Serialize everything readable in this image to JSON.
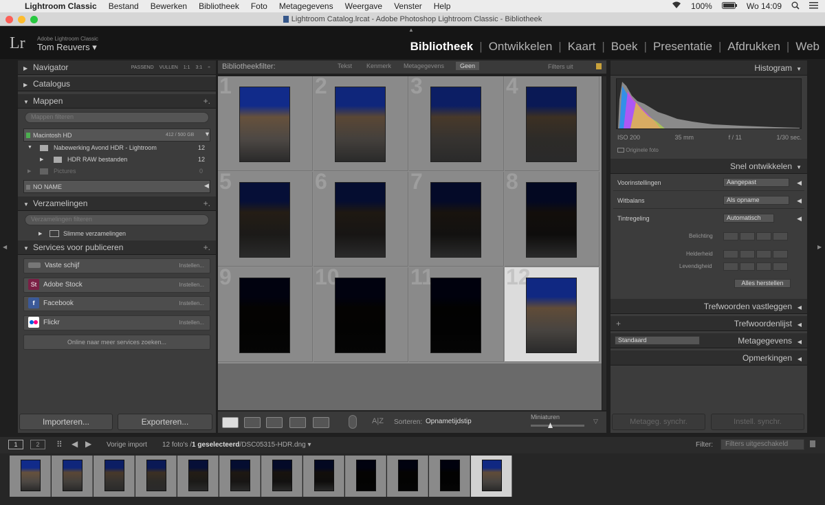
{
  "menubar": {
    "app": "Lightroom Classic",
    "items": [
      "Bestand",
      "Bewerken",
      "Bibliotheek",
      "Foto",
      "Metagegevens",
      "Weergave",
      "Venster",
      "Help"
    ],
    "battery": "100%",
    "clock": "Wo 14:09"
  },
  "window": {
    "title": "Lightroom Catalog.lrcat - Adobe Photoshop Lightroom Classic - Bibliotheek"
  },
  "identity": {
    "logo": "Lr",
    "product": "Adobe Lightroom Classic",
    "user": "Tom Reuvers ▾"
  },
  "modules": {
    "items": [
      "Bibliotheek",
      "Ontwikkelen",
      "Kaart",
      "Boek",
      "Presentatie",
      "Afdrukken",
      "Web"
    ],
    "active": "Bibliotheek"
  },
  "left": {
    "navigator": {
      "label": "Navigator",
      "zoom": [
        "PASSEND",
        "VULLEN",
        "1:1",
        "3:1"
      ]
    },
    "catalog": {
      "label": "Catalogus"
    },
    "folders": {
      "label": "Mappen",
      "search_placeholder": "Mappen filteren",
      "volume": {
        "name": "Macintosh HD",
        "size": "412 / 500 GB"
      },
      "items": [
        {
          "name": "Nabewerking Avond HDR - Lightroom",
          "count": "12"
        },
        {
          "name": "HDR RAW bestanden",
          "count": "12"
        },
        {
          "name": "Pictures",
          "count": "0"
        }
      ],
      "volume2": "NO NAME"
    },
    "collections": {
      "label": "Verzamelingen",
      "search_placeholder": "Verzamelingen filteren",
      "item": "Slimme verzamelingen"
    },
    "publish": {
      "label": "Services voor publiceren",
      "services": [
        {
          "name": "Vaste schijf",
          "action": "Instellen..."
        },
        {
          "name": "Adobe Stock",
          "action": "Instellen..."
        },
        {
          "name": "Facebook",
          "action": "Instellen..."
        },
        {
          "name": "Flickr",
          "action": "Instellen..."
        }
      ],
      "more": "Online naar meer services zoeken..."
    },
    "import_label": "Importeren...",
    "export_label": "Exporteren..."
  },
  "filterbar": {
    "label": "Bibliotheekfilter:",
    "options": [
      "Tekst",
      "Kenmerk",
      "Metagegevens",
      "Geen"
    ],
    "active": "Geen",
    "presets": "Filters uit"
  },
  "grid": {
    "cells": [
      {
        "num": "1",
        "brightness": 0.85
      },
      {
        "num": "2",
        "brightness": 0.75
      },
      {
        "num": "3",
        "brightness": 0.6
      },
      {
        "num": "4",
        "brightness": 0.5
      },
      {
        "num": "5",
        "brightness": 0.3
      },
      {
        "num": "6",
        "brightness": 0.25
      },
      {
        "num": "7",
        "brightness": 0.2
      },
      {
        "num": "8",
        "brightness": 0.15
      },
      {
        "num": "9",
        "brightness": 0.03
      },
      {
        "num": "10",
        "brightness": 0.03
      },
      {
        "num": "11",
        "brightness": 0.02
      },
      {
        "num": "12",
        "brightness": 0.8
      }
    ],
    "selected_index": 11
  },
  "toolbar": {
    "sort_label": "Sorteren:",
    "sort_value": "Opnametijdstip",
    "thumb_label": "Miniaturen"
  },
  "right": {
    "histogram": {
      "label": "Histogram",
      "iso": "ISO 200",
      "focal": "35 mm",
      "aperture": "f / 11",
      "shutter": "1/30 sec.",
      "original": "Originele foto"
    },
    "quick_develop": {
      "label": "Snel ontwikkelen",
      "preset_label": "Voorinstellingen",
      "preset_value": "Aangepast",
      "wb_label": "Witbalans",
      "wb_value": "Als opname",
      "tone_label": "Tintregeling",
      "tone_value": "Automatisch",
      "exposure": "Belichting",
      "clarity": "Helderheid",
      "vibrance": "Levendigheid",
      "reset": "Alles herstellen"
    },
    "keywording": "Trefwoorden vastleggen",
    "keyword_list": "Trefwoordenlijst",
    "metadata": {
      "label": "Metagegevens",
      "preset": "Standaard"
    },
    "comments": "Opmerkingen",
    "sync_meta": "Metageg. synchr.",
    "sync_settings": "Instell. synchr."
  },
  "filmstrip_bar": {
    "view1": "1",
    "view2": "2",
    "source": "Vorige import",
    "count": "12 foto's /",
    "selected": "1 geselecteerd",
    "file": "/DSC05315-HDR.dng ▾",
    "filter_label": "Filter:",
    "filter_value": "Filters uitgeschakeld"
  }
}
